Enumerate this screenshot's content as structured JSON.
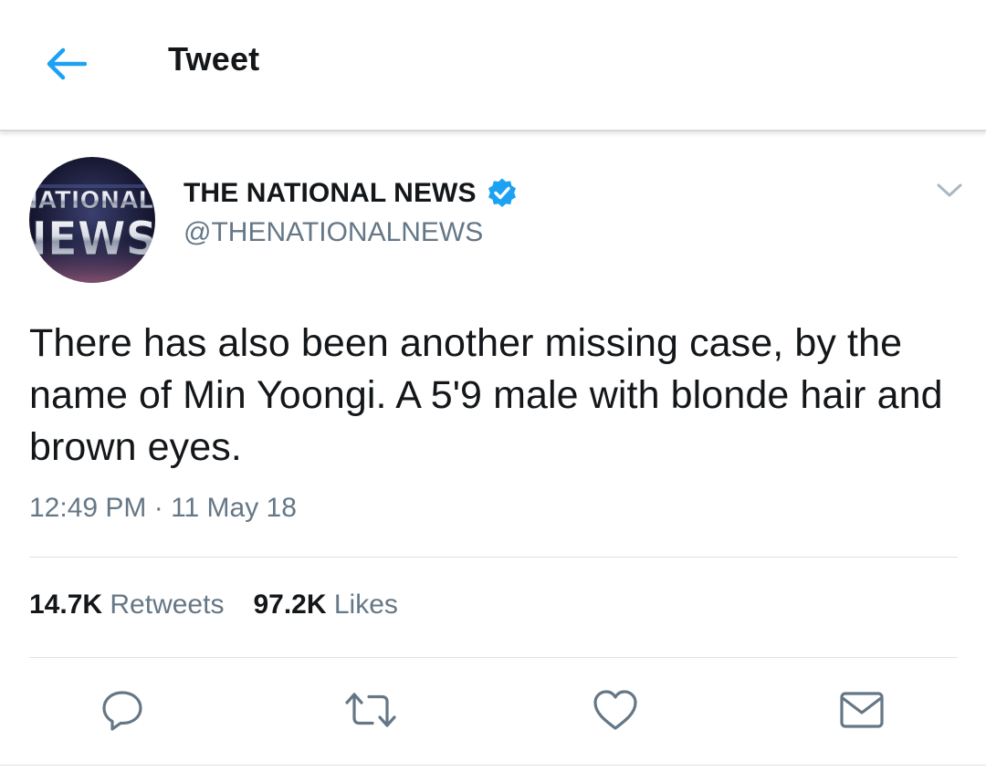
{
  "header": {
    "title": "Tweet",
    "back_icon": "arrow-left-icon"
  },
  "author": {
    "name": "THE NATIONAL NEWS",
    "handle": "@THENATIONALNEWS",
    "verified": true,
    "avatar_text_line1": "NATIONAL",
    "avatar_text_line2": "NEWS"
  },
  "tweet": {
    "text": "There has also been another missing case, by the name of Min Yoongi. A 5'9 male with blonde hair and brown eyes.",
    "timestamp": "12:49 PM · 11 May 18"
  },
  "stats": {
    "retweets_count": "14.7K",
    "retweets_label": "Retweets",
    "likes_count": "97.2K",
    "likes_label": "Likes"
  },
  "actions": [
    {
      "name": "reply",
      "icon": "reply-bubble-icon"
    },
    {
      "name": "retweet",
      "icon": "retweet-icon"
    },
    {
      "name": "like",
      "icon": "heart-icon"
    },
    {
      "name": "share",
      "icon": "envelope-icon"
    }
  ],
  "colors": {
    "accent": "#1da1f2",
    "text_primary": "#14171a",
    "text_secondary": "#657786",
    "divider": "#dfe3e6",
    "verified_badge": "#1da1f2"
  }
}
